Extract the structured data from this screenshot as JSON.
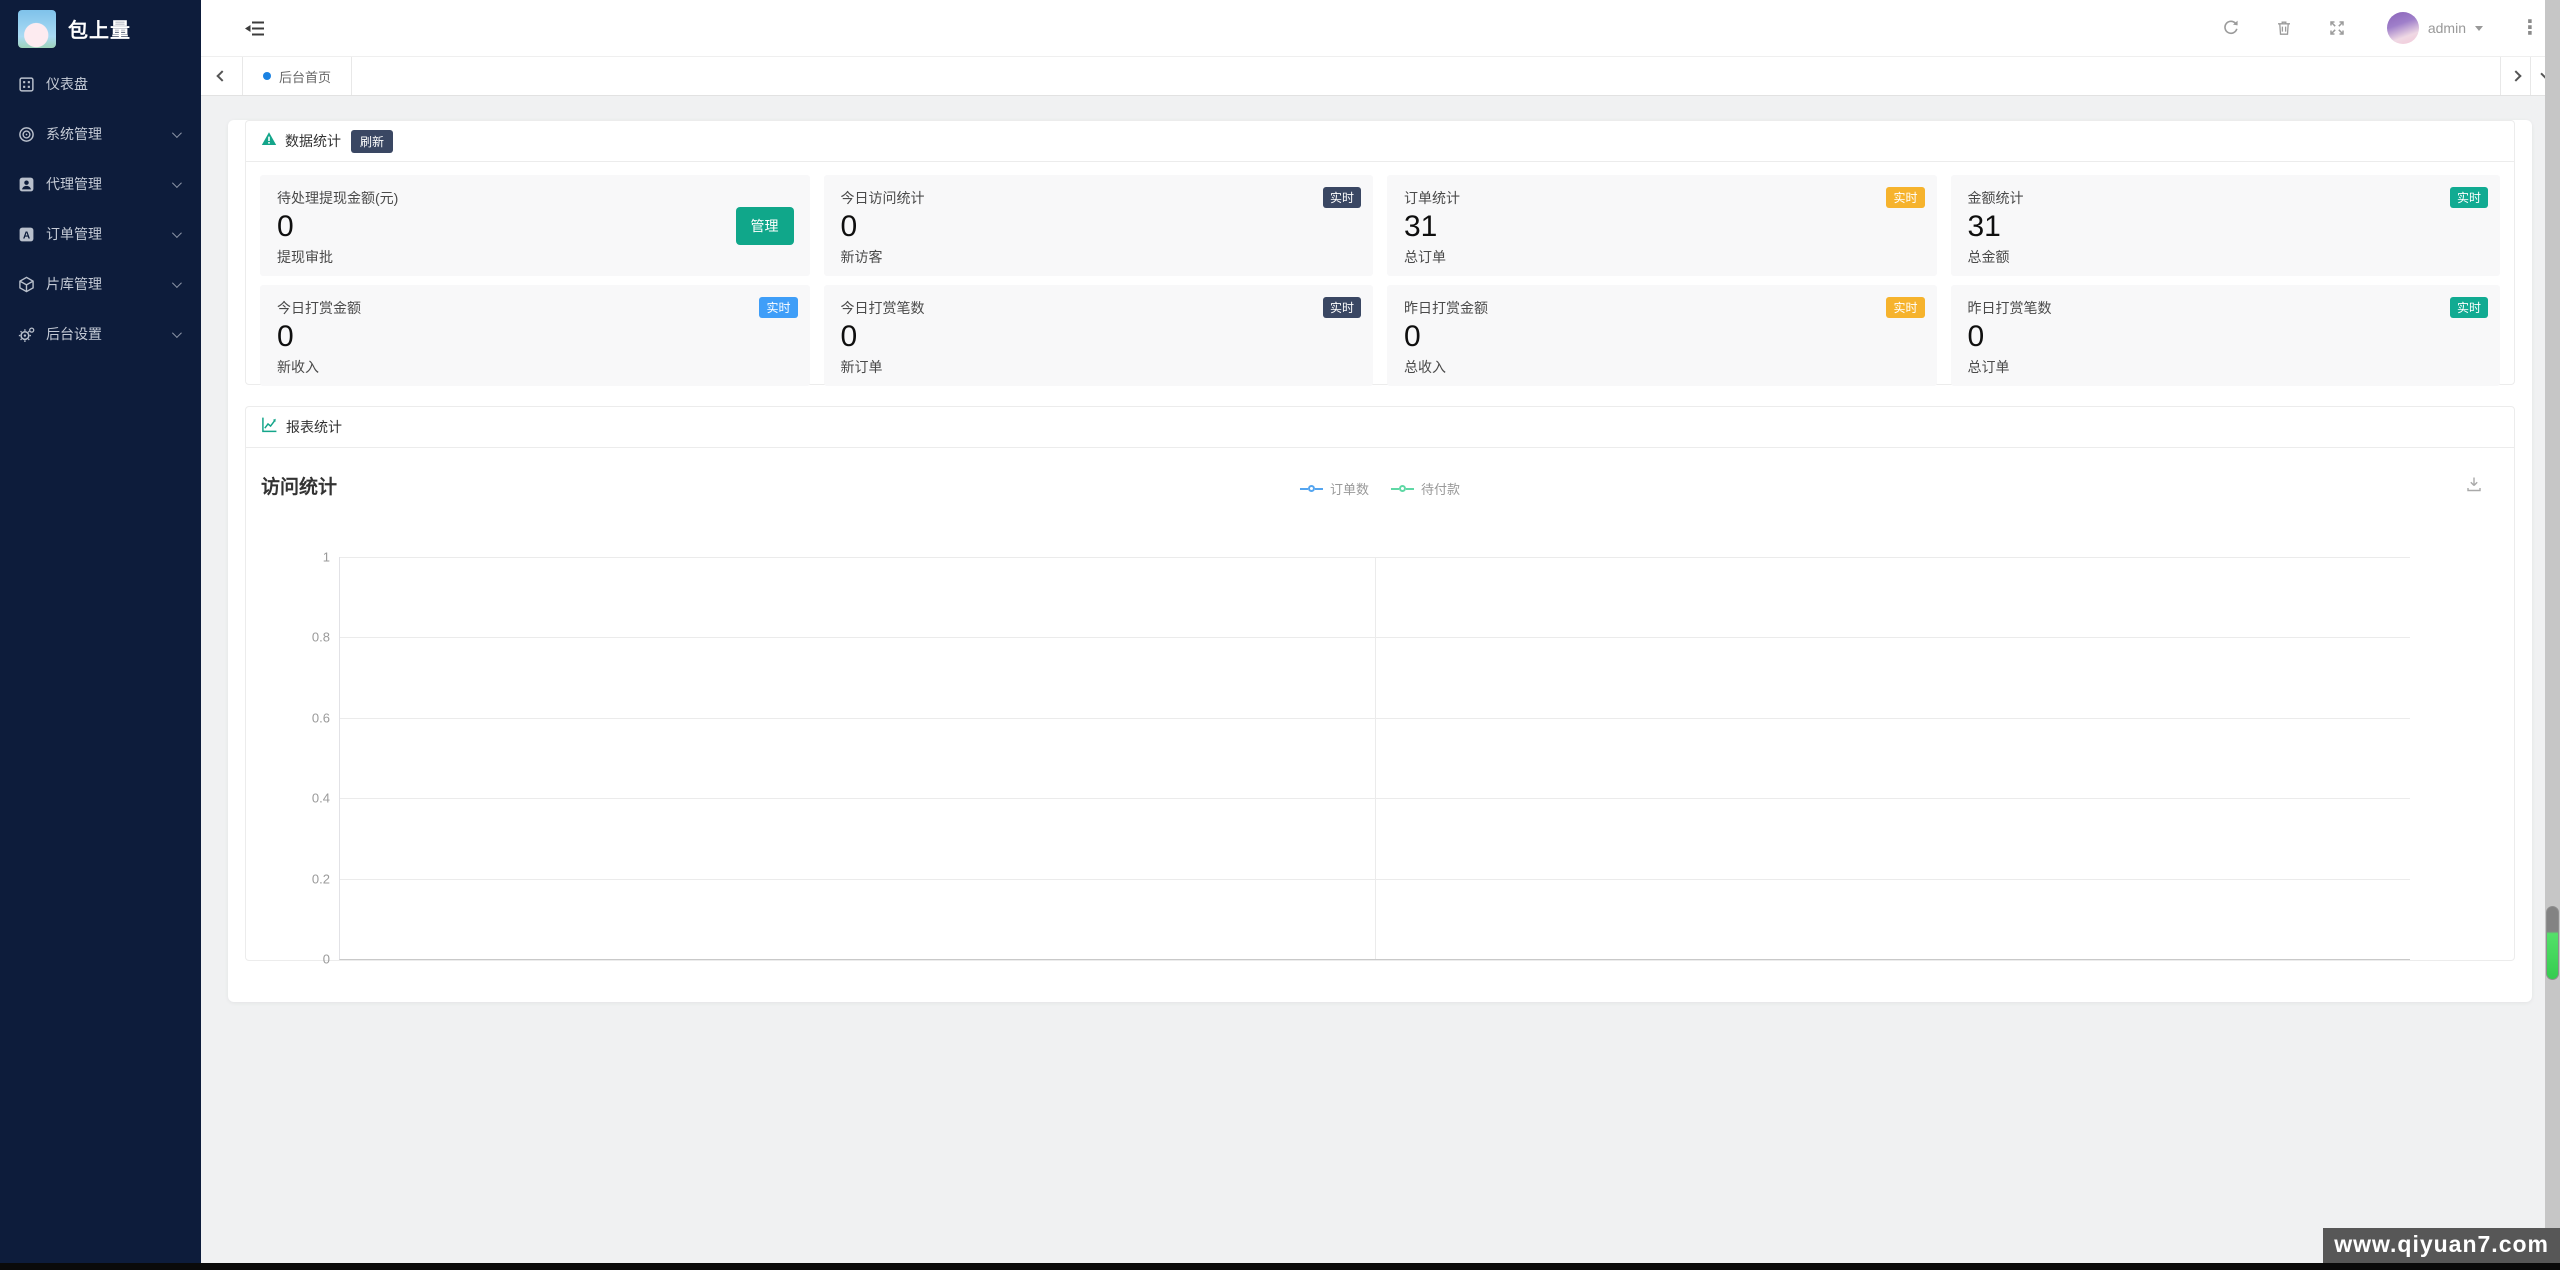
{
  "sidebar": {
    "logo_text": "包上量",
    "items": [
      {
        "label": "仪表盘",
        "icon": "dashboard-icon",
        "has_submenu": false
      },
      {
        "label": "系统管理",
        "icon": "system-icon",
        "has_submenu": true
      },
      {
        "label": "代理管理",
        "icon": "agent-icon",
        "has_submenu": true
      },
      {
        "label": "订单管理",
        "icon": "order-icon",
        "has_submenu": true
      },
      {
        "label": "片库管理",
        "icon": "media-library-icon",
        "has_submenu": true
      },
      {
        "label": "后台设置",
        "icon": "settings-icon",
        "has_submenu": true
      }
    ],
    "bg_color": "#0d1c3b"
  },
  "topbar": {
    "actions": [
      "collapse-menu-icon",
      "refresh-icon",
      "trash-icon",
      "fullscreen-icon",
      "more-icon"
    ],
    "username": "admin"
  },
  "tabbar": {
    "active_tab": "后台首页"
  },
  "stats_panel": {
    "title": "数据统计",
    "icon": "warning-triangle-icon",
    "refresh_label": "刷新",
    "cards": [
      {
        "title": "待处理提现金额(元)",
        "value": "0",
        "sub": "提现审批",
        "action_label": "管理",
        "action_color": "#10a78a"
      },
      {
        "title": "今日访问统计",
        "badge": "实时",
        "badge_color": "#3a4763",
        "value": "0",
        "sub": "新访客"
      },
      {
        "title": "订单统计",
        "badge": "实时",
        "badge_color": "#f6b32d",
        "value": "31",
        "sub": "总订单"
      },
      {
        "title": "金额统计",
        "badge": "实时",
        "badge_color": "#11ab92",
        "value": "31",
        "sub": "总金额"
      },
      {
        "title": "今日打赏金额",
        "badge": "实时",
        "badge_color": "#3f9ef8",
        "value": "0",
        "sub": "新收入"
      },
      {
        "title": "今日打赏笔数",
        "badge": "实时",
        "badge_color": "#3a4763",
        "value": "0",
        "sub": "新订单"
      },
      {
        "title": "昨日打赏金额",
        "badge": "实时",
        "badge_color": "#f6b32d",
        "value": "0",
        "sub": "总收入"
      },
      {
        "title": "昨日打赏笔数",
        "badge": "实时",
        "badge_color": "#11ab92",
        "value": "0",
        "sub": "总订单"
      }
    ]
  },
  "report_panel": {
    "title": "报表统计",
    "icon": "line-chart-icon"
  },
  "chart_data": {
    "type": "line",
    "title": "访问统计",
    "x": [],
    "series": [
      {
        "name": "订单数",
        "color": "#54a5f0",
        "values": []
      },
      {
        "name": "待付款",
        "color": "#5fd8a5",
        "values": []
      }
    ],
    "ylim": [
      0,
      1
    ],
    "y_ticks": [
      "1",
      "0.8",
      "0.6",
      "0.4",
      "0.2",
      "0"
    ],
    "grid": true,
    "legend_position": "top-center",
    "xlabel": "",
    "ylabel": ""
  },
  "watermark": "www.qiyuan7.com"
}
